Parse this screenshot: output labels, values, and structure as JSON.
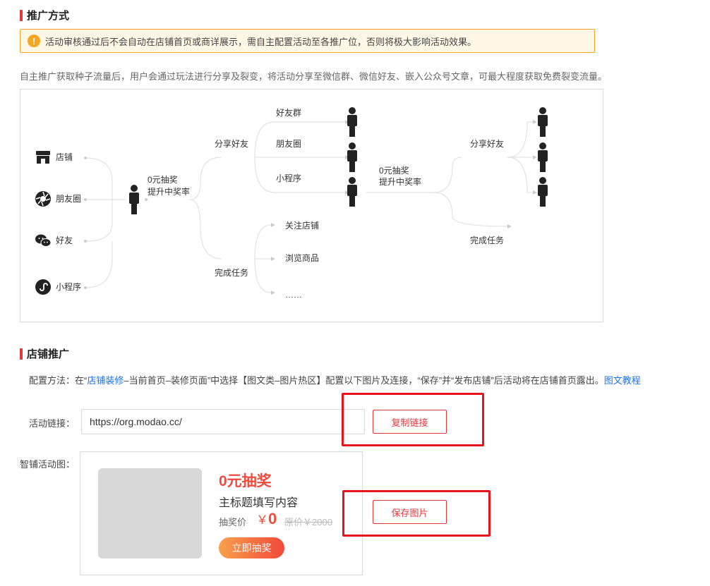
{
  "promo": {
    "title": "推广方式",
    "warning": "活动审核通过后不会自动在店铺首页或商详展示，需自主配置活动至各推广位，否则将极大影响活动效果。",
    "intro": "自主推广获取种子流量后，用户会通过玩法进行分享及裂变，将活动分享至微信群、微信好友、嵌入公众号文章，可最大程度获取免费裂变流量。"
  },
  "diagram": {
    "sources": [
      {
        "label": "店铺",
        "icon": "store-icon"
      },
      {
        "label": "朋友圈",
        "icon": "moments-icon"
      },
      {
        "label": "好友",
        "icon": "wechat-icon"
      },
      {
        "label": "小程序",
        "icon": "mini-program-icon"
      }
    ],
    "center_line1": "0元抽奖",
    "center_line2": "提升中奖率",
    "share_label": "分享好友",
    "share_targets": [
      "好友群",
      "朋友圈",
      "小程序"
    ],
    "task_label": "完成任务",
    "task_items": [
      "关注店铺",
      "浏览商品",
      "……"
    ],
    "second_line1": "0元抽奖",
    "second_line2": "提升中奖率",
    "second_share_label": "分享好友",
    "second_task_label": "完成任务"
  },
  "store": {
    "title": "店铺推广",
    "config_prefix": "配置方法：在“",
    "config_link": "店铺装修",
    "config_middle": "–当前首页–装修页面”中选择【图文类–图片热区】配置以下图片及连接，“保存”并“发布店铺”后活动将在店铺首页露出。",
    "config_tutorial": "图文教程",
    "link_label": "活动链接：",
    "link_value": "https://org.modao.cc/",
    "copy_button": "复制链接",
    "image_label": "智铺活动图：",
    "save_button": "保存图片",
    "card": {
      "title": "0元抽奖",
      "subtitle": "主标题填写内容",
      "price_label": "抽奖价",
      "currency": "￥",
      "price": "0",
      "original": "原价￥2000",
      "button": "立即抽奖"
    }
  },
  "colors": {
    "accent": "#e4393c",
    "warning": "#f5a623",
    "link": "#1a73e8",
    "card_red": "#f24a3d"
  }
}
